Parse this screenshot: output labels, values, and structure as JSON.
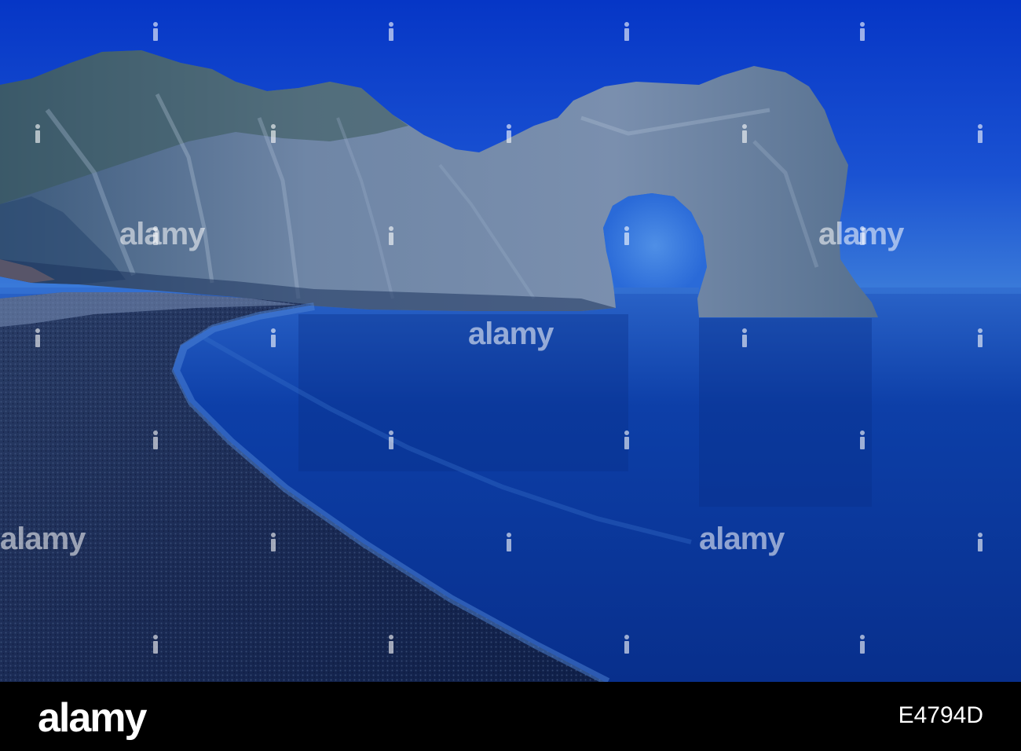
{
  "photo": {
    "subject": "sea arch at twilight with pebble beach",
    "palette": {
      "sky_top": "#0636c6",
      "sky_horizon": "#2f6fd8",
      "sea": "#0b3ea6",
      "sea_glow": "#3a7fd9",
      "rock_light": "#8aa0bd",
      "rock_dark": "#1e355f",
      "beach": "#1a2a52"
    }
  },
  "watermark": {
    "word": "alamy",
    "icon": "alamy-logo-icon"
  },
  "footer": {
    "brand": "alamy",
    "image_id": "E4794D"
  }
}
